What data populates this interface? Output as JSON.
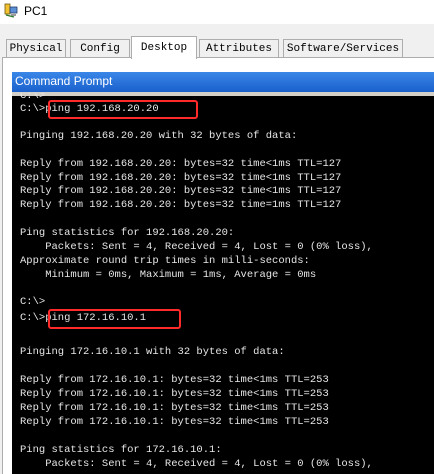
{
  "window": {
    "title": "PC1",
    "icon": "pc-device-icon"
  },
  "tabs": [
    {
      "label": "Physical",
      "active": false
    },
    {
      "label": "Config",
      "active": false
    },
    {
      "label": "Desktop",
      "active": true
    },
    {
      "label": "Attributes",
      "active": false
    },
    {
      "label": "Software/Services",
      "active": false
    }
  ],
  "command_prompt": {
    "title": "Command Prompt",
    "colors": {
      "title_bar": "#1a60cc",
      "background": "#000000",
      "text": "#e6e6e6",
      "highlight": "#ff2a2a"
    },
    "lines": [
      "C:\\>",
      "C:\\>ping 192.168.20.20",
      "",
      "Pinging 192.168.20.20 with 32 bytes of data:",
      "",
      "Reply from 192.168.20.20: bytes=32 time<1ms TTL=127",
      "Reply from 192.168.20.20: bytes=32 time<1ms TTL=127",
      "Reply from 192.168.20.20: bytes=32 time<1ms TTL=127",
      "Reply from 192.168.20.20: bytes=32 time=1ms TTL=127",
      "",
      "Ping statistics for 192.168.20.20:",
      "    Packets: Sent = 4, Received = 4, Lost = 0 (0% loss),",
      "Approximate round trip times in milli-seconds:",
      "    Minimum = 0ms, Maximum = 1ms, Average = 0ms",
      "",
      "C:\\>",
      "C:\\>ping 172.16.10.1",
      "",
      "Pinging 172.16.10.1 with 32 bytes of data:",
      "",
      "Reply from 172.16.10.1: bytes=32 time<1ms TTL=253",
      "Reply from 172.16.10.1: bytes=32 time<1ms TTL=253",
      "Reply from 172.16.10.1: bytes=32 time<1ms TTL=253",
      "Reply from 172.16.10.1: bytes=32 time<1ms TTL=253",
      "",
      "Ping statistics for 172.16.10.1:",
      "    Packets: Sent = 4, Received = 4, Lost = 0 (0% loss),"
    ]
  }
}
